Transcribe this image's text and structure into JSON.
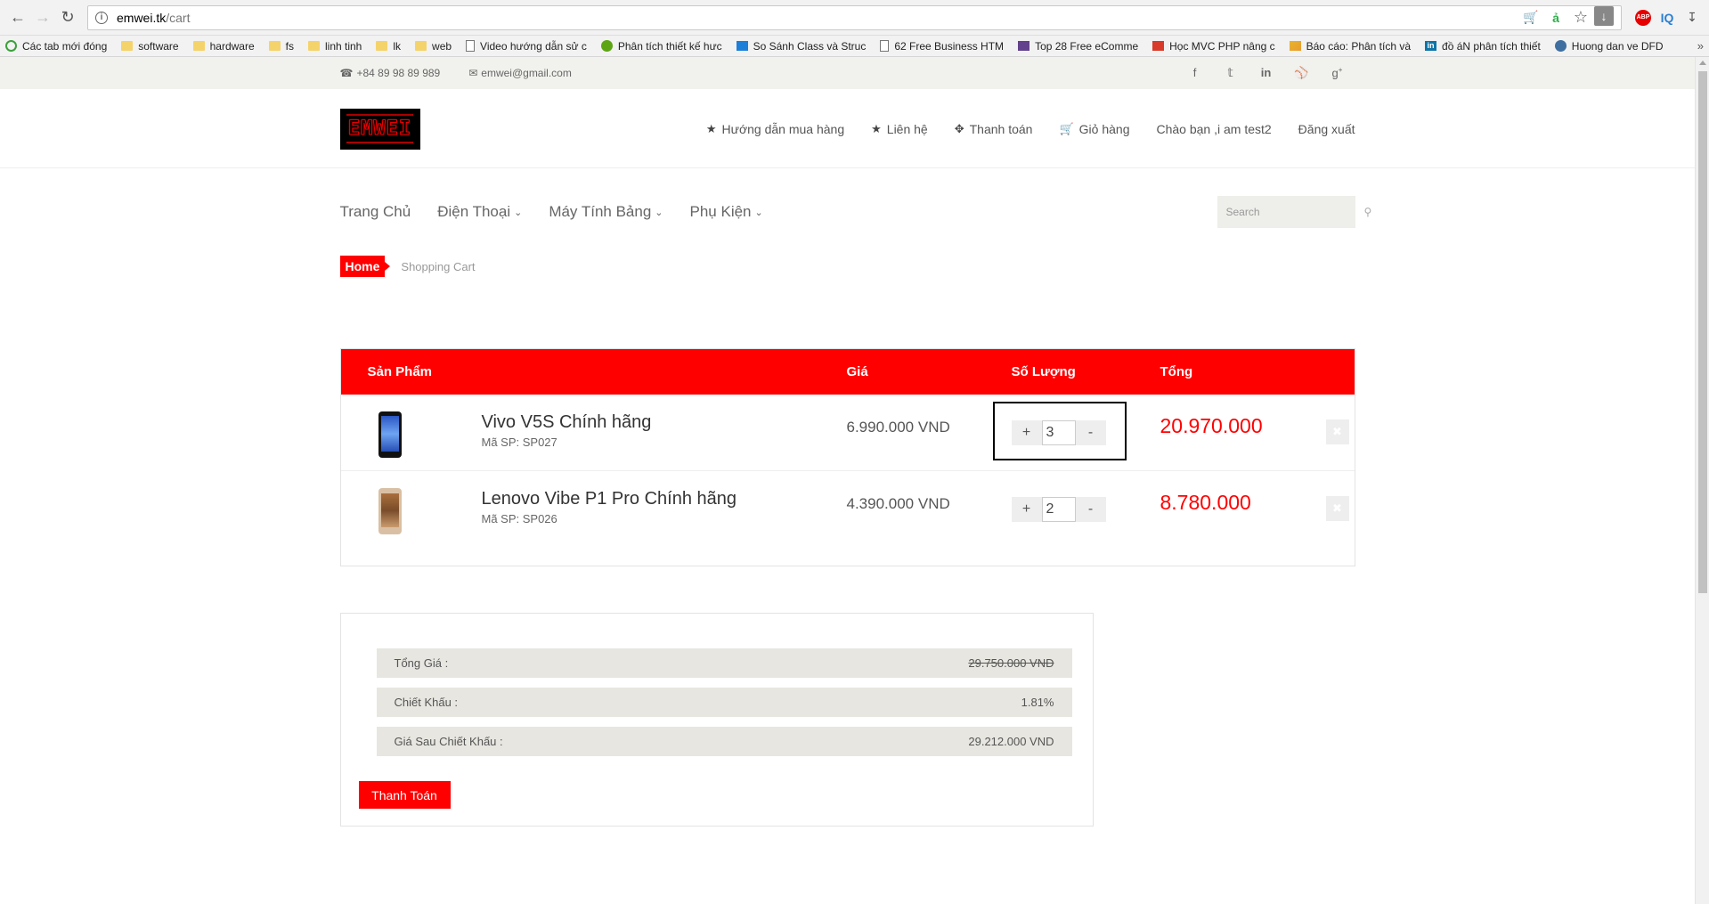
{
  "browser": {
    "url_host": "emwei.tk",
    "url_path": "/cart",
    "bookmarks": [
      {
        "label": "Các tab mới đóng",
        "icon": "recent-tabs-icon"
      },
      {
        "label": "software",
        "icon": "folder-icon"
      },
      {
        "label": "hardware",
        "icon": "folder-icon"
      },
      {
        "label": "fs",
        "icon": "folder-icon"
      },
      {
        "label": "linh tinh",
        "icon": "folder-icon"
      },
      {
        "label": "lk",
        "icon": "folder-icon"
      },
      {
        "label": "web",
        "icon": "folder-icon"
      },
      {
        "label": "Video hướng dẫn sử c",
        "icon": "page-icon"
      },
      {
        "label": "Phân tích thiết kế hưc",
        "icon": "green-icon"
      },
      {
        "label": "So Sánh Class và Struc",
        "icon": "blue-icon"
      },
      {
        "label": "62 Free Business HTM",
        "icon": "page-icon"
      },
      {
        "label": "Top 28 Free eComme",
        "icon": "purple-icon"
      },
      {
        "label": "Học MVC PHP nâng c",
        "icon": "red-icon"
      },
      {
        "label": "Báo cáo: Phân tích và",
        "icon": "pencil-icon"
      },
      {
        "label": "đồ áN phân tích thiết",
        "icon": "linkedin-icon"
      },
      {
        "label": "Huong dan ve DFD",
        "icon": "globe-icon"
      }
    ],
    "more": "»"
  },
  "topbar": {
    "phone": "+84 89 98 89 989",
    "email": "emwei@gmail.com"
  },
  "logo": {
    "text": "EMWEI"
  },
  "header_menu": [
    {
      "label": "Hướng dẫn mua hàng",
      "icon": "star-icon"
    },
    {
      "label": "Liên hệ",
      "icon": "star-icon"
    },
    {
      "label": "Thanh toán",
      "icon": "crosshair-icon"
    },
    {
      "label": "Giỏ hàng",
      "icon": "cart-icon"
    },
    {
      "label": "Chào bạn ,i am test2",
      "icon": ""
    },
    {
      "label": "Đăng xuất",
      "icon": ""
    }
  ],
  "nav": [
    {
      "label": "Trang Chủ"
    },
    {
      "label": "Điện Thoại"
    },
    {
      "label": "Máy Tính Bảng"
    },
    {
      "label": "Phụ Kiện"
    }
  ],
  "search": {
    "placeholder": "Search"
  },
  "breadcrumb": {
    "home": "Home",
    "current": "Shopping Cart"
  },
  "cart": {
    "headers": {
      "product": "Sản Phẩm",
      "price": "Giá",
      "qty": "Số Lượng",
      "total": "Tổng"
    },
    "items": [
      {
        "name": "Vivo V5S Chính hãng",
        "code": "Mã SP: SP027",
        "price": "6.990.000 VND",
        "qty": "3",
        "total": "20.970.000",
        "plus": "+",
        "minus": "-",
        "remove": "✖"
      },
      {
        "name": "Lenovo Vibe P1 Pro Chính hãng",
        "code": "Mã SP: SP026",
        "price": "4.390.000 VND",
        "qty": "2",
        "total": "8.780.000",
        "plus": "+",
        "minus": "-",
        "remove": "✖"
      }
    ]
  },
  "summary": {
    "subtotal_label": "Tổng Giá :",
    "subtotal_value": "29.750.000 VND",
    "discount_label": "Chiết Khấu :",
    "discount_value": "1.81%",
    "final_label": "Giá Sau Chiết Khấu :",
    "final_value": "29.212.000 VND",
    "checkout_label": "Thanh Toán"
  },
  "colors": {
    "accent": "#ff0000"
  }
}
